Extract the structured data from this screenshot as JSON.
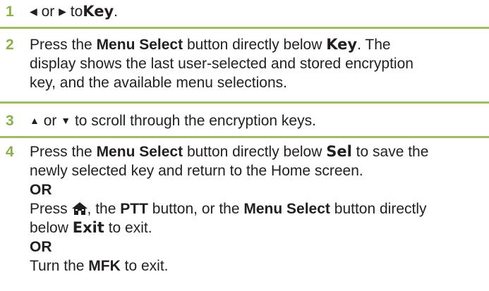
{
  "steps": [
    {
      "number": "1",
      "left_symbol": "◀",
      "or": "or",
      "right_symbol": "▶",
      "to": "to",
      "display_key": "Key",
      "end": "."
    },
    {
      "number": "2",
      "press": "Press the",
      "menu_select": "Menu Select",
      "directly_below": "button directly below",
      "display_key": "Key",
      "rest_line1": ". The",
      "rest_line2": "display shows the last user-selected and stored encryption",
      "rest_line3": "key, and the available menu selections."
    },
    {
      "number": "3",
      "up_symbol": "▲",
      "or": "or",
      "down_symbol": "▼",
      "text": "to scroll through the encryption keys."
    },
    {
      "number": "4",
      "press": "Press the",
      "menu_select": "Menu Select",
      "directly_below": "button directly below",
      "display_sel": "Sel",
      "text_a1": "to save the",
      "text_a2": "newly selected key and return to the Home screen.",
      "or1": "OR",
      "press2": "Press",
      "comma_the": ", the",
      "ptt": "PTT",
      "button_or_the": "button, or the",
      "menu_select2": "Menu Select",
      "button_directly": "button directly",
      "below": "below",
      "display_exit": "Exit",
      "to_exit": "to exit.",
      "or2": "OR",
      "turn_the": "Turn the",
      "mfk": "MFK",
      "to_exit2": "to exit."
    }
  ],
  "colors": {
    "number": "#8bb04a",
    "rule": "#9dbf62",
    "text": "#231f20"
  },
  "icons": {
    "home": "home-icon"
  }
}
